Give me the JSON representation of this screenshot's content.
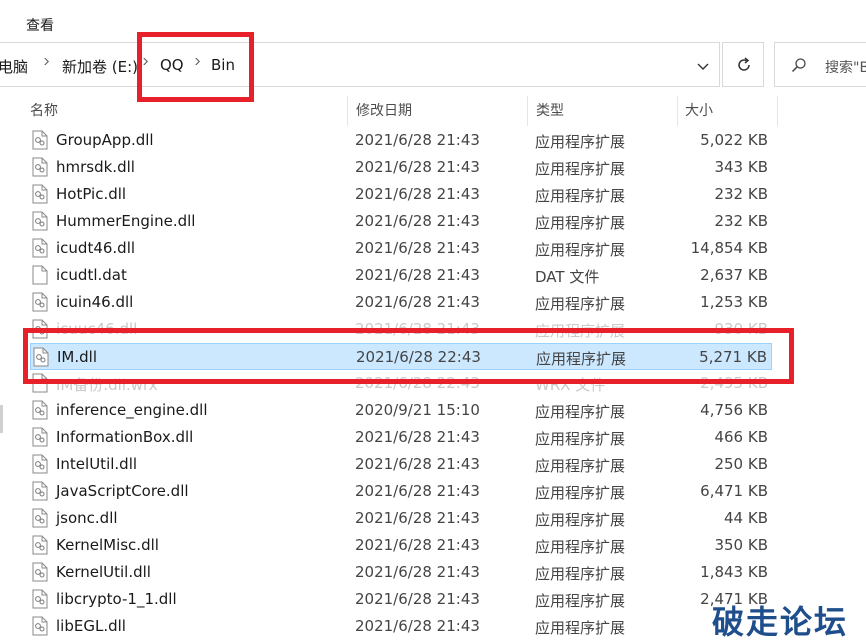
{
  "ribbon": {
    "view_label": "查看"
  },
  "address": {
    "crumbs": [
      "此电脑",
      "新加卷 (E:)",
      "QQ",
      "Bin"
    ]
  },
  "search": {
    "placeholder": "搜索\"Bin\""
  },
  "columns": {
    "name": "名称",
    "date": "修改日期",
    "type": "类型",
    "size": "大小"
  },
  "files": [
    {
      "name": "GroupApp.dll",
      "date": "2021/6/28 21:43",
      "type": "应用程序扩展",
      "size": "5,022 KB"
    },
    {
      "name": "hmrsdk.dll",
      "date": "2021/6/28 21:43",
      "type": "应用程序扩展",
      "size": "343 KB"
    },
    {
      "name": "HotPic.dll",
      "date": "2021/6/28 21:43",
      "type": "应用程序扩展",
      "size": "232 KB"
    },
    {
      "name": "HummerEngine.dll",
      "date": "2021/6/28 21:43",
      "type": "应用程序扩展",
      "size": "232 KB"
    },
    {
      "name": "icudt46.dll",
      "date": "2021/6/28 21:43",
      "type": "应用程序扩展",
      "size": "14,854 KB"
    },
    {
      "name": "icudtl.dat",
      "date": "2021/6/28 21:43",
      "type": "DAT 文件",
      "size": "2,637 KB"
    },
    {
      "name": "icuin46.dll",
      "date": "2021/6/28 21:43",
      "type": "应用程序扩展",
      "size": "1,253 KB"
    },
    {
      "name": "icuuc46.dll",
      "date": "2021/6/28 21:43",
      "type": "应用程序扩展",
      "size": "930 KB"
    },
    {
      "name": "IM.dll",
      "date": "2021/6/28 22:43",
      "type": "应用程序扩展",
      "size": "5,271 KB"
    },
    {
      "name": "IM备份.dll.wrx",
      "date": "2021/6/28 22:43",
      "type": "WRX 文件",
      "size": "2,495 KB"
    },
    {
      "name": "inference_engine.dll",
      "date": "2020/9/21 15:10",
      "type": "应用程序扩展",
      "size": "4,756 KB"
    },
    {
      "name": "InformationBox.dll",
      "date": "2021/6/28 21:43",
      "type": "应用程序扩展",
      "size": "466 KB"
    },
    {
      "name": "IntelUtil.dll",
      "date": "2021/6/28 21:43",
      "type": "应用程序扩展",
      "size": "250 KB"
    },
    {
      "name": "JavaScriptCore.dll",
      "date": "2021/6/28 21:43",
      "type": "应用程序扩展",
      "size": "6,471 KB"
    },
    {
      "name": "jsonc.dll",
      "date": "2021/6/28 21:43",
      "type": "应用程序扩展",
      "size": "44 KB"
    },
    {
      "name": "KernelMisc.dll",
      "date": "2021/6/28 21:43",
      "type": "应用程序扩展",
      "size": "350 KB"
    },
    {
      "name": "KernelUtil.dll",
      "date": "2021/6/28 21:43",
      "type": "应用程序扩展",
      "size": "1,843 KB"
    },
    {
      "name": "libcrypto-1_1.dll",
      "date": "2021/6/28 21:43",
      "type": "应用程序扩展",
      "size": "2,471 KB"
    },
    {
      "name": "libEGL.dll",
      "date": "2021/6/28 21:43",
      "type": "应用程序扩展",
      "size": ""
    }
  ],
  "selected_file": "IM.dll",
  "watermark": "破走论坛",
  "colors": {
    "highlight_red": "#e8202a",
    "selection_bg": "#cce8ff",
    "selection_border": "#99d1ff",
    "watermark": "#1f4e8c"
  },
  "icons": [
    "chevron-right-icon",
    "chevron-down-icon",
    "refresh-icon",
    "search-icon",
    "dll-file-icon",
    "generic-file-icon"
  ]
}
